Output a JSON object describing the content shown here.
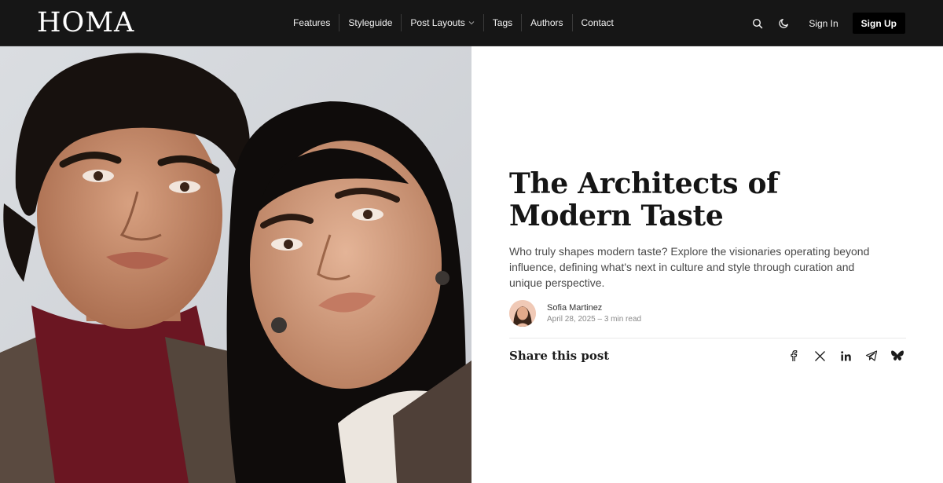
{
  "header": {
    "logo": "HOMA",
    "nav": [
      {
        "label": "Features"
      },
      {
        "label": "Styleguide"
      },
      {
        "label": "Post Layouts",
        "has_dropdown": true
      },
      {
        "label": "Tags"
      },
      {
        "label": "Authors"
      },
      {
        "label": "Contact"
      }
    ],
    "icons": {
      "search": "search-icon",
      "theme": "moon-icon"
    },
    "signin_label": "Sign In",
    "signup_label": "Sign Up"
  },
  "post": {
    "title": "The Architects of Modern Taste",
    "excerpt": "Who truly shapes modern taste? Explore the visionaries operating beyond influence, defining what's next in culture and style through curation and unique perspective.",
    "author": {
      "name": "Sofia Martinez",
      "date": "April 28, 2025",
      "read_time": "3 min read",
      "meta": "April 28, 2025 – 3 min read"
    },
    "share": {
      "label": "Share this post",
      "networks": [
        "facebook-icon",
        "x-icon",
        "linkedin-icon",
        "telegram-icon",
        "bluesky-icon"
      ]
    }
  },
  "colors": {
    "header_bg": "#161616",
    "signup_bg": "#000000",
    "title": "#151515",
    "body_text": "#4a4a4a"
  }
}
